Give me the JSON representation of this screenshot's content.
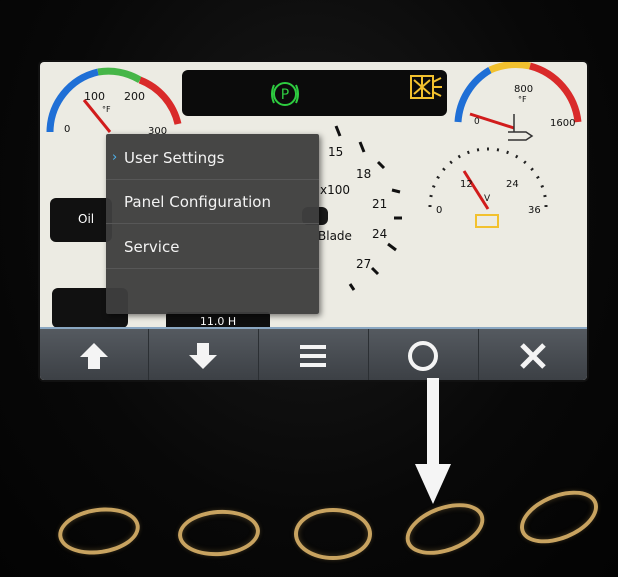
{
  "status": {
    "park_label": "P"
  },
  "gauges": {
    "oil_temp": {
      "ticks": [
        "0",
        "100",
        "200",
        "300"
      ],
      "unit": "°F"
    },
    "exhaust_temp": {
      "ticks": [
        "0",
        "800",
        "1600"
      ],
      "unit": "°F"
    },
    "rpm": {
      "ticks": [
        "15",
        "18",
        "21",
        "24",
        "27"
      ],
      "multiplier": "x100",
      "label": "Blade"
    },
    "voltage": {
      "ticks": [
        "0",
        "12",
        "24",
        "36"
      ],
      "unit": "V"
    }
  },
  "oil_label": "Oil",
  "hour_meter": "11.0 H",
  "menu": {
    "items": [
      {
        "label": "User Settings",
        "selected": true
      },
      {
        "label": "Panel Configuration",
        "selected": false
      },
      {
        "label": "Service",
        "selected": false
      },
      {
        "label": "",
        "selected": false
      }
    ],
    "selection_color": "#4fb5f0"
  },
  "softkeys": [
    "up-arrow-icon",
    "down-arrow-icon",
    "menu-lines-icon",
    "circle-icon",
    "close-icon"
  ],
  "hardware_buttons": 5,
  "colors": {
    "screen_bg": "#ecebe3",
    "menu_bg": "#3e3e3e",
    "accent_ring": "#c8a360",
    "park_green": "#2ecc40",
    "warning_yellow": "#f2c12e"
  }
}
